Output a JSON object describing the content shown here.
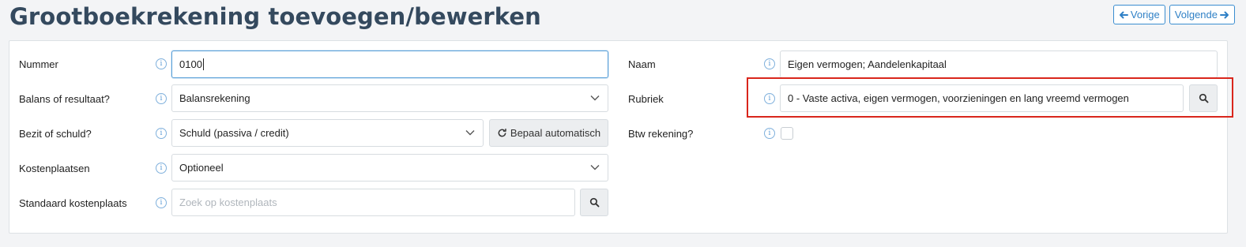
{
  "page": {
    "title": "Grootboekrekening toevoegen/bewerken"
  },
  "nav": {
    "prev_label": "Vorige",
    "next_label": "Volgende"
  },
  "form": {
    "nummer": {
      "label": "Nummer",
      "value": "0100"
    },
    "balans": {
      "label": "Balans of resultaat?",
      "value": "Balansrekening"
    },
    "bezit": {
      "label": "Bezit of schuld?",
      "value": "Schuld (passiva / credit)",
      "auto_button": "Bepaal automatisch"
    },
    "kostenplaatsen": {
      "label": "Kostenplaatsen",
      "value": "Optioneel"
    },
    "standaard_kostenplaats": {
      "label": "Standaard kostenplaats",
      "placeholder": "Zoek op kostenplaats"
    },
    "naam": {
      "label": "Naam",
      "value": "Eigen vermogen; Aandelenkapitaal"
    },
    "rubriek": {
      "label": "Rubriek",
      "value": "0 - Vaste activa, eigen vermogen, voorzieningen en lang vreemd vermogen"
    },
    "btw": {
      "label": "Btw rekening?",
      "checked": false
    }
  },
  "colors": {
    "accent": "#2f80c6",
    "title": "#34495e",
    "highlight": "#d9261c"
  },
  "icons": {
    "info": "info-circle-icon",
    "search": "search-icon",
    "refresh": "refresh-icon",
    "chevron": "chevron-down-icon"
  }
}
